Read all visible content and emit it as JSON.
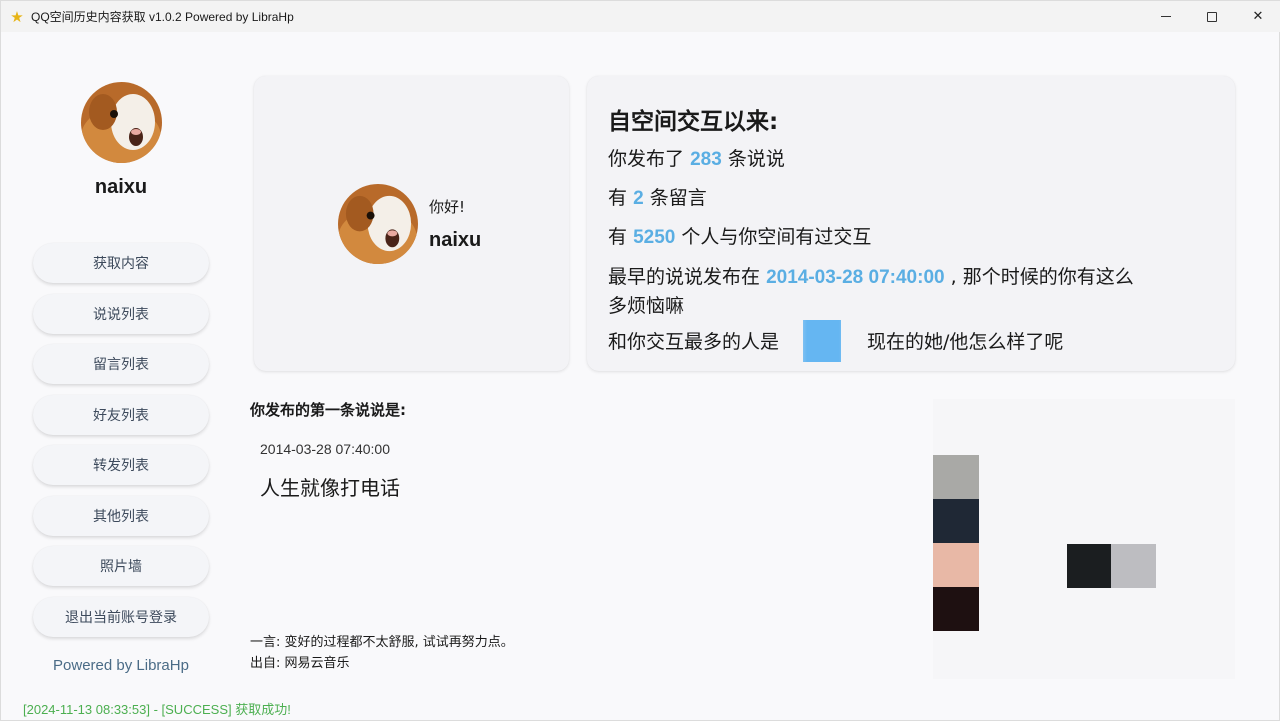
{
  "window": {
    "title": "QQ空间历史内容获取 v1.0.2 Powered by LibraHp",
    "controls": {
      "minimize": "minimize",
      "maximize": "maximize",
      "close": "✕"
    }
  },
  "sidebar": {
    "username": "naixu",
    "items": [
      {
        "label": "获取内容"
      },
      {
        "label": "说说列表"
      },
      {
        "label": "留言列表"
      },
      {
        "label": "好友列表"
      },
      {
        "label": "转发列表"
      },
      {
        "label": "其他列表"
      },
      {
        "label": "照片墙"
      },
      {
        "label": "退出当前账号登录"
      }
    ],
    "powered": "Powered by LibraHp"
  },
  "profile_card": {
    "greeting": "你好!",
    "username": "naixu"
  },
  "stats": {
    "title": "自空间交互以来:",
    "line1_prefix": "你发布了",
    "posts_count": "283",
    "line1_suffix": "条说说",
    "line2_prefix": "有",
    "messages_count": "2",
    "line2_suffix": "条留言",
    "line3_prefix": "有",
    "people_count": "5250",
    "line3_suffix": "个人与你空间有过交互",
    "line4_prefix": "最早的说说发布在",
    "earliest_date": "2014-03-28 07:40:00",
    "line4_suffix": ", 那个时候的你有这么",
    "line4_cont": "多烦恼嘛",
    "line5_prefix": "和你交互最多的人是",
    "line5_suffix": "现在的她/他怎么样了呢"
  },
  "first_post": {
    "label": "你发布的第一条说说是:",
    "date": "2014-03-28 07:40:00",
    "content": "人生就像打电话"
  },
  "quote": {
    "text": "一言: 变好的过程都不太舒服, 试试再努力点。",
    "source": "出自: 网易云音乐"
  },
  "status": {
    "message": "[2024-11-13 08:33:53] - [SUCCESS] 获取成功!",
    "color": "#4caf50"
  },
  "colors": {
    "accent": "#5aaee3",
    "masked_name_block": "#65b6f2",
    "app_icon": "#e7b416"
  }
}
